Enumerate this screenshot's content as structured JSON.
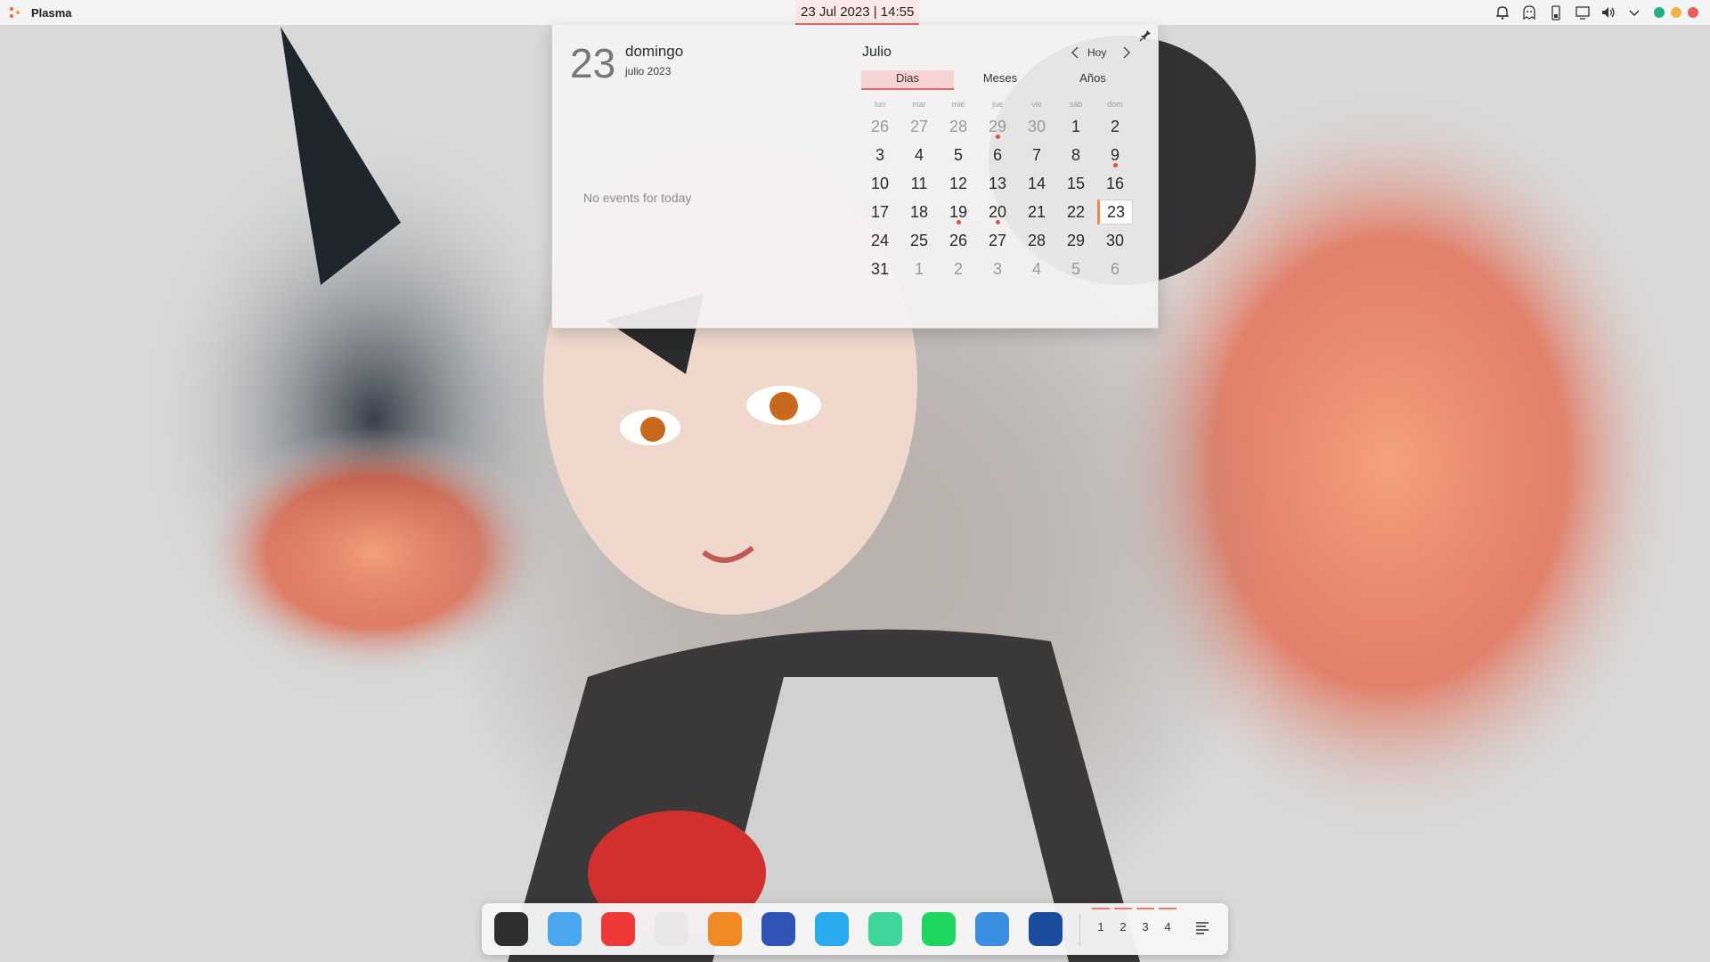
{
  "panel": {
    "launcher_label": "Plasma",
    "clock": "23 Jul 2023 | 14:55",
    "tray_icons": [
      "alarm-icon",
      "ghost-icon",
      "battery-icon",
      "display-icon",
      "volume-icon",
      "chevron-down-icon"
    ],
    "window_dots": [
      "#22b07d",
      "#f1b24a",
      "#ec5b5b"
    ]
  },
  "calendar": {
    "day_number": "23",
    "weekday": "domingo",
    "month_year": "julio 2023",
    "no_events": "No events for today",
    "month_title": "Julio",
    "today_button": "Hoy",
    "tabs": {
      "days": "Dias",
      "months": "Meses",
      "years": "Años"
    },
    "weekday_headers": [
      "lun",
      "mar",
      "mié",
      "jue",
      "vie",
      "sáb",
      "dom"
    ],
    "weeks": [
      [
        "26",
        "27",
        "28",
        "29",
        "30",
        "1",
        "2"
      ],
      [
        "3",
        "4",
        "5",
        "6",
        "7",
        "8",
        "9"
      ],
      [
        "10",
        "11",
        "12",
        "13",
        "14",
        "15",
        "16"
      ],
      [
        "17",
        "18",
        "19",
        "20",
        "21",
        "22",
        "23"
      ],
      [
        "24",
        "25",
        "26",
        "27",
        "28",
        "29",
        "30"
      ],
      [
        "31",
        "1",
        "2",
        "3",
        "4",
        "5",
        "6"
      ]
    ],
    "other_month_days": [
      [
        0,
        0
      ],
      [
        0,
        1
      ],
      [
        0,
        2
      ],
      [
        0,
        3
      ],
      [
        0,
        4
      ],
      [
        5,
        1
      ],
      [
        5,
        2
      ],
      [
        5,
        3
      ],
      [
        5,
        4
      ],
      [
        5,
        5
      ],
      [
        5,
        6
      ]
    ],
    "event_days": [
      [
        0,
        3
      ],
      [
        1,
        6
      ],
      [
        3,
        2
      ],
      [
        3,
        3
      ]
    ],
    "today": [
      3,
      6
    ],
    "accent_color": "#e46a6a",
    "event_color": "#e34b4b"
  },
  "dock": {
    "apps": [
      {
        "name": "terminal-icon",
        "color": "#2f2f2f"
      },
      {
        "name": "files-icon",
        "color": "#4aa6ee"
      },
      {
        "name": "vivaldi-icon",
        "color": "#ef3939"
      },
      {
        "name": "inkscape-icon",
        "color": "#e8e8e8"
      },
      {
        "name": "mail-icon",
        "color": "#f08a24"
      },
      {
        "name": "podcast-icon",
        "color": "#3153b5"
      },
      {
        "name": "transfer-icon",
        "color": "#29a9ee"
      },
      {
        "name": "music-icon",
        "color": "#3fd69b"
      },
      {
        "name": "spotify-icon",
        "color": "#1ed760"
      },
      {
        "name": "qbittorrent-icon",
        "color": "#3c8fe0"
      },
      {
        "name": "steam-icon",
        "color": "#1b4c9e"
      }
    ],
    "desktops": [
      "1",
      "2",
      "3",
      "4"
    ]
  }
}
